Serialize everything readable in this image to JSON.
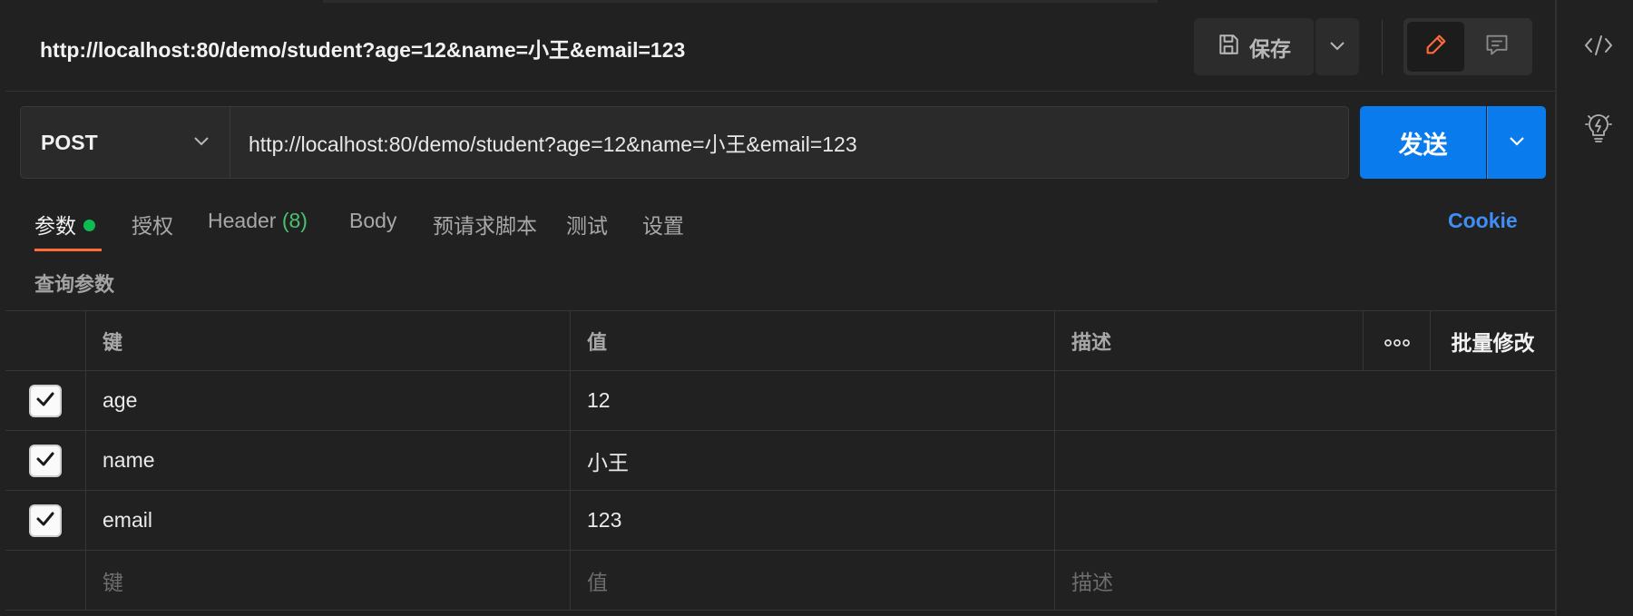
{
  "header": {
    "title": "http://localhost:80/demo/student?age=12&name=小王&email=123",
    "save_label": "保存",
    "icons": [
      "save-icon",
      "chevron-down-icon",
      "pencil-icon",
      "comment-icon"
    ]
  },
  "request": {
    "method": "POST",
    "url": "http://localhost:80/demo/student?age=12&name=小王&email=123",
    "send_label": "发送"
  },
  "tabs": {
    "params": "参数",
    "auth": "授权",
    "header": "Header",
    "header_count": "(8)",
    "body": "Body",
    "prerequest": "预请求脚本",
    "tests": "测试",
    "settings": "设置",
    "cookie": "Cookie"
  },
  "params_section": {
    "label": "查询参数",
    "columns": {
      "key": "键",
      "value": "值",
      "description": "描述",
      "more": "ooo",
      "bulk_edit": "批量修改"
    },
    "rows": [
      {
        "checked": true,
        "key": "age",
        "value": "12",
        "description": ""
      },
      {
        "checked": true,
        "key": "name",
        "value": "小王",
        "description": ""
      },
      {
        "checked": true,
        "key": "email",
        "value": "123",
        "description": ""
      }
    ],
    "new_row_placeholders": {
      "key": "键",
      "value": "值",
      "description": "描述"
    }
  },
  "colors": {
    "accent_orange": "#ff6c37",
    "send_blue": "#097bed",
    "link_blue": "#3f8ef5",
    "status_green": "#0cbb52"
  },
  "rightbar": {
    "icons": [
      "code-icon",
      "lightbulb-icon"
    ]
  }
}
